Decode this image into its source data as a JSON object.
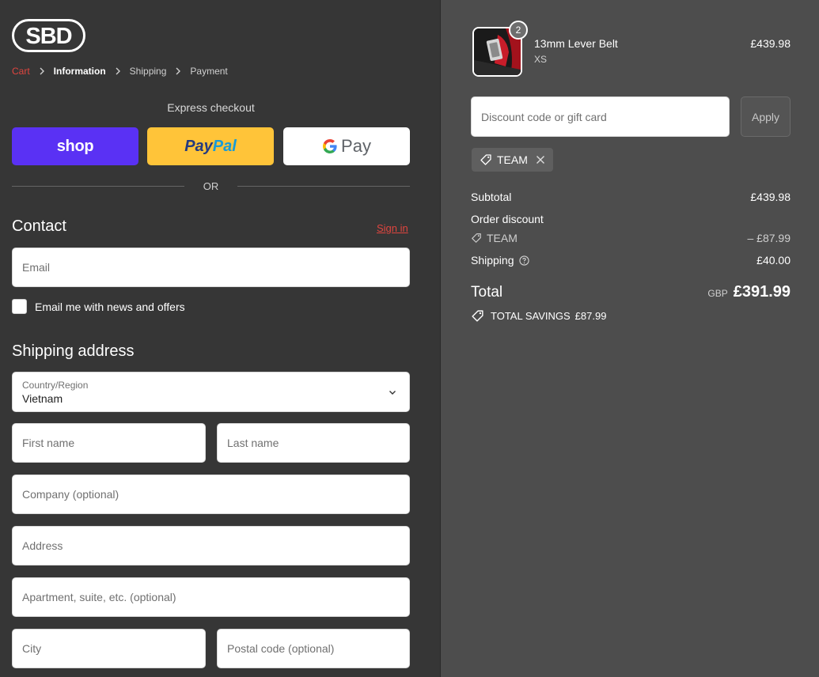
{
  "brand": {
    "logo_text": "SBD"
  },
  "breadcrumb": {
    "items": [
      "Cart",
      "Information",
      "Shipping",
      "Payment"
    ]
  },
  "express": {
    "title": "Express checkout",
    "shop_label": "shop",
    "paypal_pay": "Pay",
    "paypal_pal": "Pal",
    "gpay_label": "Pay",
    "or_text": "OR"
  },
  "contact": {
    "title": "Contact",
    "signin": "Sign in",
    "email_placeholder": "Email",
    "newsletter_label": "Email me with news and offers"
  },
  "shipping": {
    "title": "Shipping address",
    "country_label": "Country/Region",
    "country_value": "Vietnam",
    "first_name_placeholder": "First name",
    "last_name_placeholder": "Last name",
    "company_placeholder": "Company (optional)",
    "address_placeholder": "Address",
    "apartment_placeholder": "Apartment, suite, etc. (optional)",
    "city_placeholder": "City",
    "postal_placeholder": "Postal code (optional)"
  },
  "summary": {
    "product": {
      "quantity": "2",
      "name": "13mm Lever Belt",
      "variant": "XS",
      "price": "£439.98"
    },
    "discount_placeholder": "Discount code or gift card",
    "apply_label": "Apply",
    "applied_code": "TEAM",
    "subtotal_label": "Subtotal",
    "subtotal_value": "£439.98",
    "order_discount_label": "Order discount",
    "discount_code": "TEAM",
    "discount_value": "– £87.99",
    "shipping_label": "Shipping",
    "shipping_value": "£40.00",
    "total_label": "Total",
    "currency": "GBP",
    "total_value": "£391.99",
    "savings_label": "TOTAL SAVINGS",
    "savings_value": "£87.99"
  },
  "colors": {
    "left_bg": "#363636",
    "right_bg": "#4d4d4d",
    "accent_red": "#e0453f",
    "shop_purple": "#5a31f4",
    "paypal_yellow": "#ffc439"
  }
}
